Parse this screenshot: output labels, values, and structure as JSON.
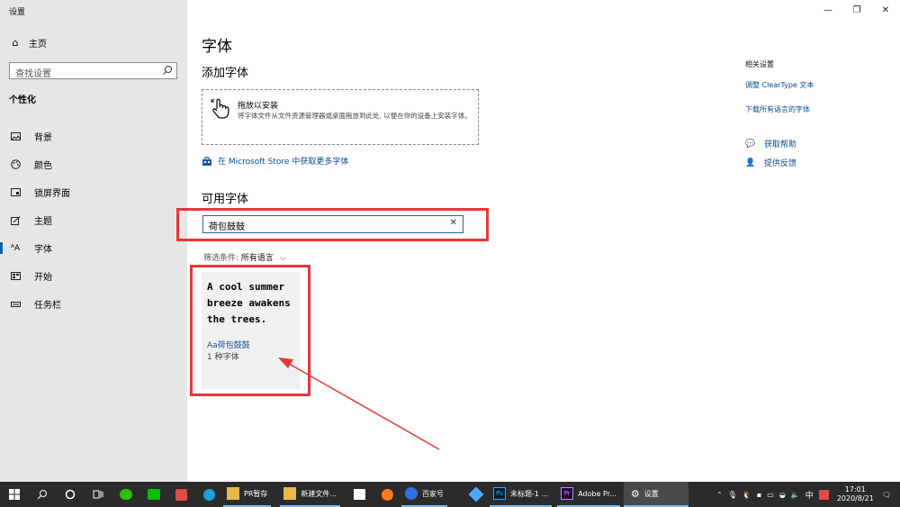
{
  "window": {
    "title": "设置"
  },
  "sidebar": {
    "home": "主页",
    "search_placeholder": "查找设置",
    "section": "个性化",
    "items": [
      {
        "label": "背景",
        "icon": "image-icon"
      },
      {
        "label": "颜色",
        "icon": "palette-icon"
      },
      {
        "label": "锁屏界面",
        "icon": "lock-screen-icon"
      },
      {
        "label": "主题",
        "icon": "theme-icon"
      },
      {
        "label": "字体",
        "icon": "font-icon"
      },
      {
        "label": "开始",
        "icon": "start-icon"
      },
      {
        "label": "任务栏",
        "icon": "taskbar-icon"
      }
    ]
  },
  "main": {
    "title": "字体",
    "add_heading": "添加字体",
    "drop_title": "拖放以安装",
    "drop_desc": "将字体文件从文件资源管理器或桌面拖放到此处, 以便在你的设备上安装字体。",
    "store_link": "在 Microsoft Store 中获取更多字体",
    "available_heading": "可用字体",
    "font_search_value": "荷包鼓鼓",
    "filter_label": "筛选条件:",
    "filter_value": "所有语言",
    "font_card": {
      "sample": "A cool summer breeze awakens the trees.",
      "name": "Aa荷包鼓鼓",
      "count": "1 种字体"
    }
  },
  "related": {
    "heading": "相关设置",
    "links": [
      "调整 ClearType 文本",
      "下载所有语言的字体"
    ],
    "help": "获取帮助",
    "feedback": "提供反馈"
  },
  "taskbar": {
    "apps": [
      {
        "label": "PR暂存",
        "color": "#e8b84a"
      },
      {
        "label": "新建文件...",
        "color": "#e8b84a"
      },
      {
        "label": "百家号",
        "color": "#2d6fe0"
      },
      {
        "label": "未标题-1 ...",
        "color": "#31a8ff"
      },
      {
        "label": "Adobe Pr...",
        "color": "#9999ff"
      },
      {
        "label": "设置",
        "color": "#ffffff"
      }
    ],
    "ime": "中",
    "time": "17:01",
    "date": "2020/8/21"
  },
  "colors": {
    "accent": "#0063b1",
    "highlight": "#e53838",
    "link": "#0a4b8f"
  }
}
